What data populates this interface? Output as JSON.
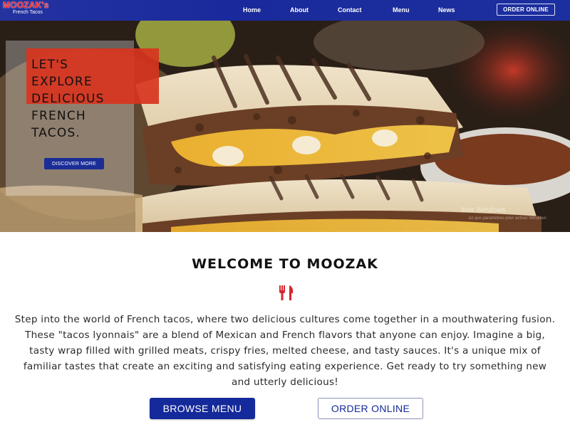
{
  "brand": {
    "name": "MOOZAK's",
    "tagline": "French Tacos"
  },
  "nav": {
    "items": [
      "Home",
      "About",
      "Contact",
      "Menu",
      "News"
    ],
    "order_label": "ORDER ONLINE"
  },
  "hero": {
    "title": "LET'S\nEXPLORE\nDELICIOUS\nFRENCH\nTACOS.",
    "cta_label": "DISCOVER MORE",
    "watermark_line1": "tiver Windows",
    "watermark_line2": "ez aux paramètres pour activer Windows"
  },
  "welcome": {
    "title": "WELCOME TO MOOZAK",
    "icon": "fork-knife-icon",
    "body": "Step into the world of French tacos, where two delicious cultures come together in a mouthwatering fusion. These \"tacos lyonnais\" are a blend of Mexican and French flavors that anyone can enjoy. Imagine a big, tasty wrap filled with grilled meats, crispy fries, melted cheese, and tasty sauces. It's a unique mix of familiar tastes that create an exciting and satisfying eating experience. Get ready to try something new and utterly delicious!",
    "browse_label": "BROWSE MENU",
    "order_label": "ORDER ONLINE"
  },
  "colors": {
    "nav_bg": "#1c2f9e",
    "brand_red": "#e8222d",
    "button_blue": "#14299a",
    "icon_red": "#d6252f"
  }
}
